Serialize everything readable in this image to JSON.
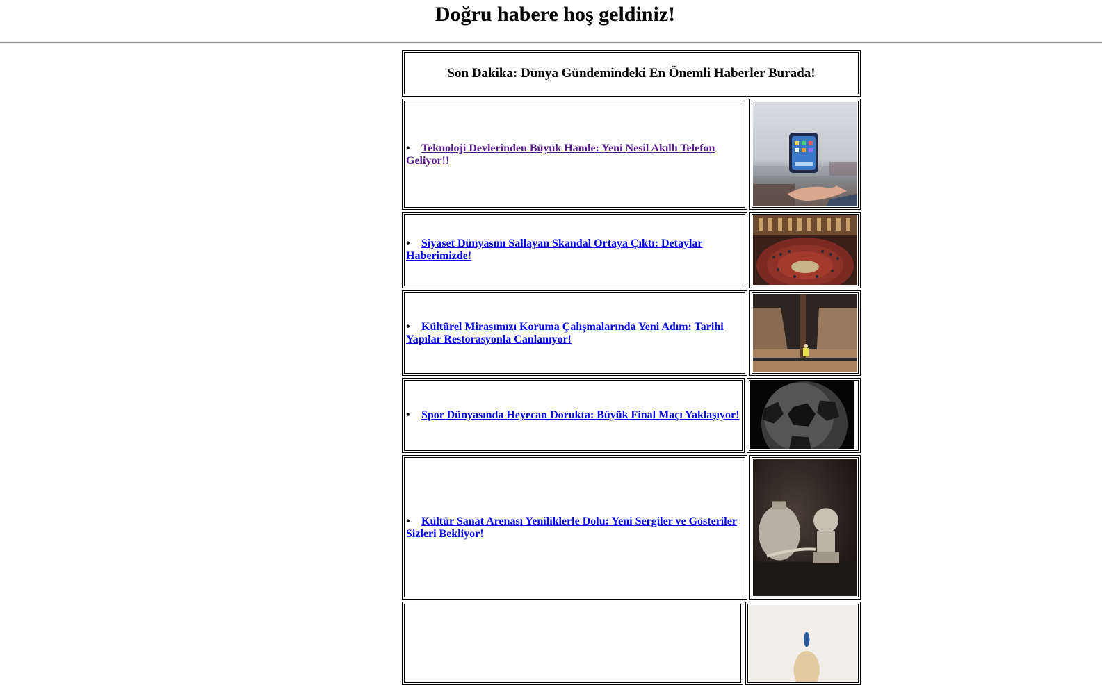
{
  "page": {
    "heading": "Doğru habere hoş geldiniz!"
  },
  "headline": "Son Dakika: Dünya Gündemindeki En Önemli Haberler Burada!",
  "news": [
    {
      "title": "Teknoloji Devlerinden Büyük Hamle: Yeni Nesil Akıllı Telefon Geliyor!!",
      "image": "smartphone-photo",
      "visited": true
    },
    {
      "title": "Siyaset Dünyasını Sallayan Skandal Ortaya Çıktı: Detaylar Haberimizde!",
      "image": "parliament-photo",
      "visited": false
    },
    {
      "title": "Kültürel Mirasımızı Koruma Çalışmalarında Yeni Adım: Tarihi Yapılar Restorasyonla Canlanıyor!",
      "image": "restoration-photo",
      "visited": false
    },
    {
      "title": "Spor Dünyasında Heyecan Dorukta: Büyük Final Maçı Yaklaşıyor!",
      "image": "football-photo",
      "visited": false
    },
    {
      "title": "Kültür Sanat Arenası Yeniliklerle Dolu: Yeni Sergiler ve Gösteriler Sizleri Bekliyor!",
      "image": "still-life-photo",
      "visited": false
    }
  ],
  "bullet": "•"
}
